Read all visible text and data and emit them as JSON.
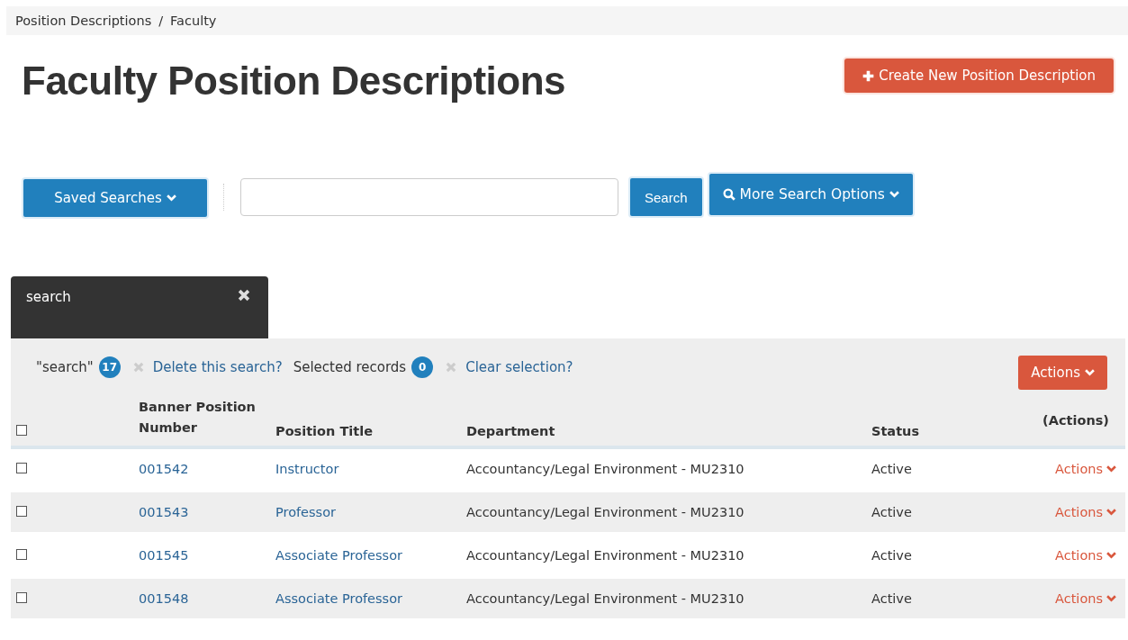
{
  "breadcrumb": {
    "items": [
      "Position Descriptions",
      "Faculty"
    ],
    "separator": "/"
  },
  "title": "Faculty Position Descriptions",
  "create_button": "Create New Position Description",
  "toolbar": {
    "saved_searches": "Saved Searches",
    "search_button": "Search",
    "more_options": "More Search Options"
  },
  "search_tab": {
    "label": "search",
    "selected": true
  },
  "summary": {
    "query": "\"search\"",
    "count": "17",
    "delete_link": "Delete this search?",
    "selected_label": "Selected records",
    "selected_count": "0",
    "clear_link": "Clear selection?"
  },
  "actions_button": "Actions",
  "table": {
    "select_all": {
      "checked": false
    },
    "columns": [
      "Banner Position Number",
      "Position Title",
      "Department",
      "Status",
      "(Actions)"
    ],
    "rows": [
      {
        "checked": false,
        "number": "001542",
        "title": "Instructor",
        "department": "Accountancy/Legal Environment - MU2310",
        "status": "Active",
        "actions": "Actions"
      },
      {
        "checked": false,
        "number": "001543",
        "title": "Professor",
        "department": "Accountancy/Legal Environment - MU2310",
        "status": "Active",
        "actions": "Actions"
      },
      {
        "checked": false,
        "number": "001545",
        "title": "Associate Professor",
        "department": "Accountancy/Legal Environment - MU2310",
        "status": "Active",
        "actions": "Actions"
      },
      {
        "checked": false,
        "number": "001548",
        "title": "Associate Professor",
        "department": "Accountancy/Legal Environment - MU2310",
        "status": "Active",
        "actions": "Actions"
      }
    ]
  }
}
